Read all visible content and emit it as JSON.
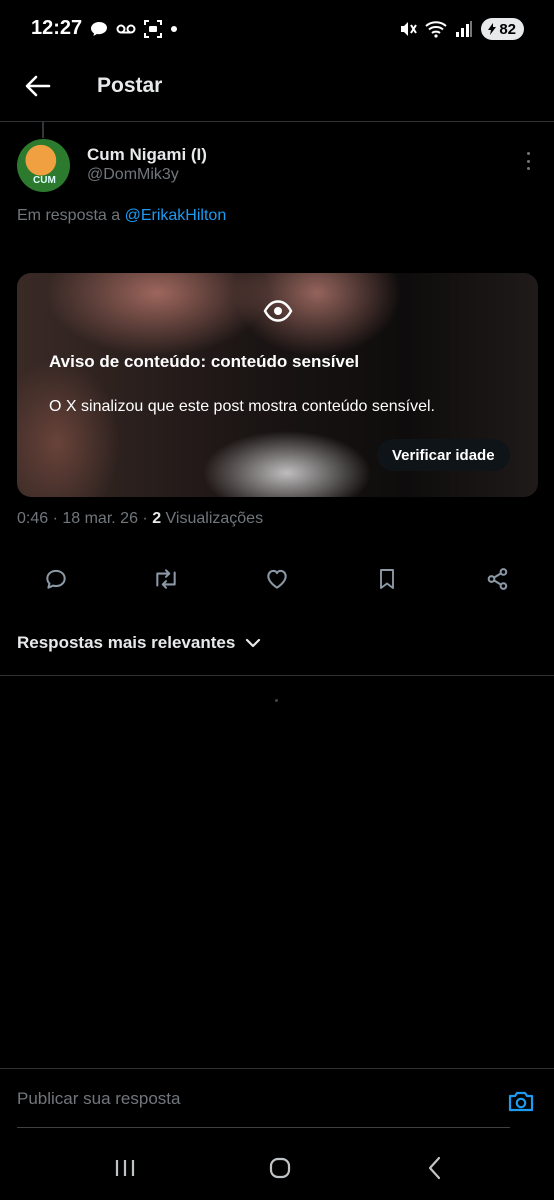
{
  "status_bar": {
    "time": "12:27",
    "battery": "82",
    "icons": [
      "chat-bubble-icon",
      "voicemail-icon",
      "screenshot-icon",
      "dot-icon",
      "mute-icon",
      "wifi-icon",
      "signal-icon",
      "battery-icon"
    ]
  },
  "header": {
    "title": "Postar"
  },
  "post": {
    "author_name": "Cum Nigami (I)",
    "author_handle": "@DomMik3y",
    "avatar_text": "CUM",
    "reply_prefix": "Em resposta a ",
    "reply_mention": "@ErikakHilton",
    "media_warning": {
      "title": "Aviso de conteúdo: conteúdo sensível",
      "description": "O X sinalizou que este post mostra conteúdo sensível.",
      "button_label": "Verificar idade"
    },
    "timestamp": "0:46 · 18 mar. 26 · ",
    "views_count": "2",
    "views_label": " Visualizações"
  },
  "actions": [
    "reply-icon",
    "repost-icon",
    "like-icon",
    "bookmark-icon",
    "share-icon"
  ],
  "replies_sort": {
    "label": "Respostas mais relevantes"
  },
  "reply_bar": {
    "placeholder": "Publicar sua resposta"
  },
  "colors": {
    "background": "#000000",
    "text": "#e7e9ea",
    "muted": "#71767b",
    "accent": "#1d9bf0"
  }
}
